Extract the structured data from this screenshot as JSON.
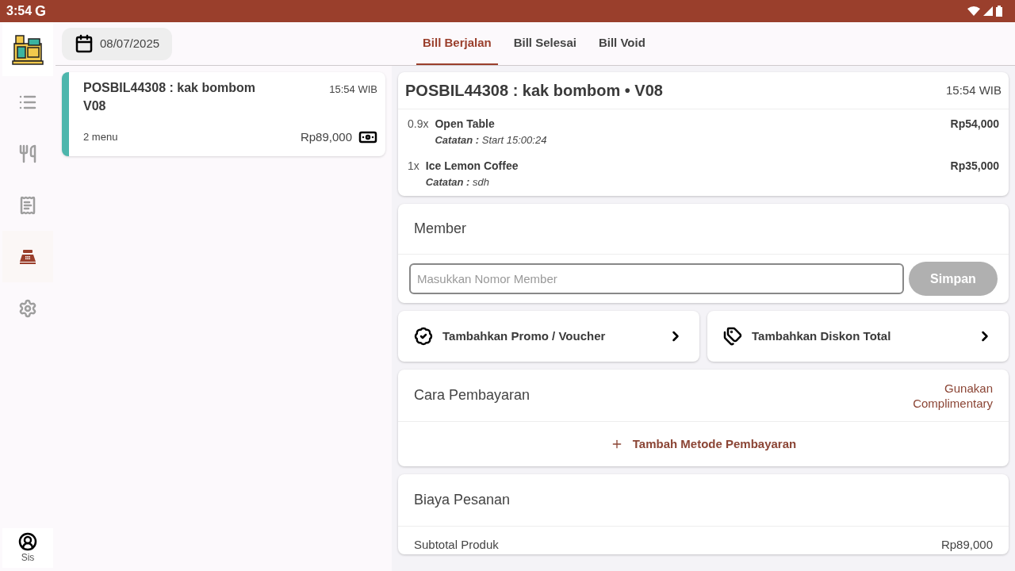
{
  "status_bar": {
    "time": "3:54",
    "g": "G"
  },
  "sidebar": {
    "items": [
      {
        "kind": "list",
        "selected": false
      },
      {
        "kind": "food",
        "selected": false
      },
      {
        "kind": "receipt",
        "selected": false
      },
      {
        "kind": "register",
        "selected": true
      },
      {
        "kind": "settings",
        "selected": false
      }
    ],
    "user": "Sis"
  },
  "date": "08/07/2025",
  "tabs": [
    {
      "label": "Bill Berjalan",
      "selected": true
    },
    {
      "label": "Bill Selesai",
      "selected": false
    },
    {
      "label": "Bill Void",
      "selected": false
    }
  ],
  "bills": [
    {
      "title": "POSBIL44308 : kak bombom V08",
      "time": "15:54 WIB",
      "count": "2 menu",
      "total": "Rp89,000",
      "selected": true
    }
  ],
  "detail": {
    "title": "POSBIL44308 : kak bombom • V08",
    "time": "15:54 WIB",
    "items": [
      {
        "qty": "0.9x",
        "name": "Open Table",
        "note": "**Catatan :** Start 15:00:24",
        "price": "Rp54,000"
      },
      {
        "qty": "1x",
        "name": "Ice Lemon Coffee",
        "note": "**Catatan :** sdh",
        "price": "Rp35,000"
      }
    ]
  },
  "member": {
    "title": "Member",
    "placeholder": "Masukkan Nomor Member",
    "button": "Simpan",
    "disabled": true
  },
  "actions": [
    {
      "kind": "promo",
      "label": "Tambahkan Promo / Voucher"
    },
    {
      "kind": "discount",
      "label": "Tambahkan Diskon Total"
    }
  ],
  "payment": {
    "title": "Cara Pembayaran",
    "complimentary": "Gunakan\nComplimentary",
    "add": "Tambah Metode Pembayaran"
  },
  "fees": {
    "title": "Biaya Pesanan",
    "rows": [
      {
        "label": "Subtotal Produk",
        "value": "Rp89,000"
      }
    ]
  }
}
